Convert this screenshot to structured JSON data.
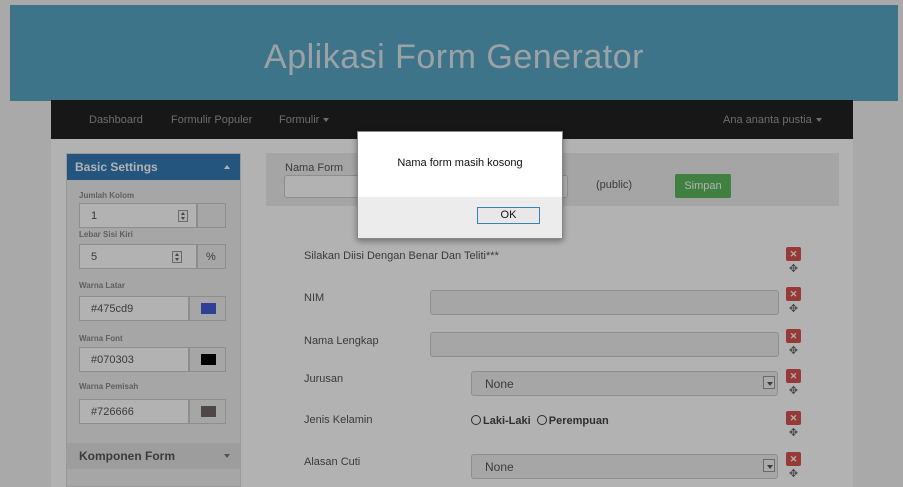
{
  "app": {
    "title": "Aplikasi Form Generator"
  },
  "navbar": {
    "items": [
      {
        "label": "Dashboard"
      },
      {
        "label": "Formulir Populer"
      },
      {
        "label": "Formulir"
      }
    ],
    "user": "Ana ananta pustia"
  },
  "sidebar": {
    "heading": "Basic Settings",
    "jumlah_kolom_label": "Jumlah Kolom",
    "jumlah_kolom_value": "1",
    "lebar_label": "Lebar Sisi Kiri",
    "lebar_value": "5",
    "lebar_unit": "%",
    "warna_latar_label": "Warna Latar",
    "warna_latar_value": "#475cd9",
    "warna_font_label": "Warna Font",
    "warna_font_value": "#070303",
    "warna_pemisah_label": "Warna Pemisah",
    "warna_pemisah_value": "#726666",
    "komponen_heading": "Komponen Form"
  },
  "form": {
    "nama_form_label": "Nama Form",
    "nama_form_value": "",
    "visibility": "(public)",
    "save_label": "Simpan",
    "instruction": "Silakan Diisi Dengan Benar Dan Teliti***",
    "nim_label": "NIM",
    "nama_lengkap_label": "Nama Lengkap",
    "jurusan_label": "Jurusan",
    "jurusan_value": "None",
    "jenis_kelamin_label": "Jenis Kelamin",
    "gender_options": [
      "Laki-Laki",
      "Perempuan"
    ],
    "alasan_cuti_label": "Alasan Cuti",
    "alasan_cuti_value": "None"
  },
  "dialog": {
    "message": "Nama form masih kosong",
    "ok_label": "OK"
  },
  "icons": {
    "remove": "close-icon",
    "move": "move-icon",
    "caret": "chevron-down-icon"
  },
  "colors": {
    "header_bg": "#5aa6c5",
    "navbar_bg": "#222222",
    "primary": "#337ab7",
    "success": "#5cb85c",
    "danger": "#d9534f"
  }
}
